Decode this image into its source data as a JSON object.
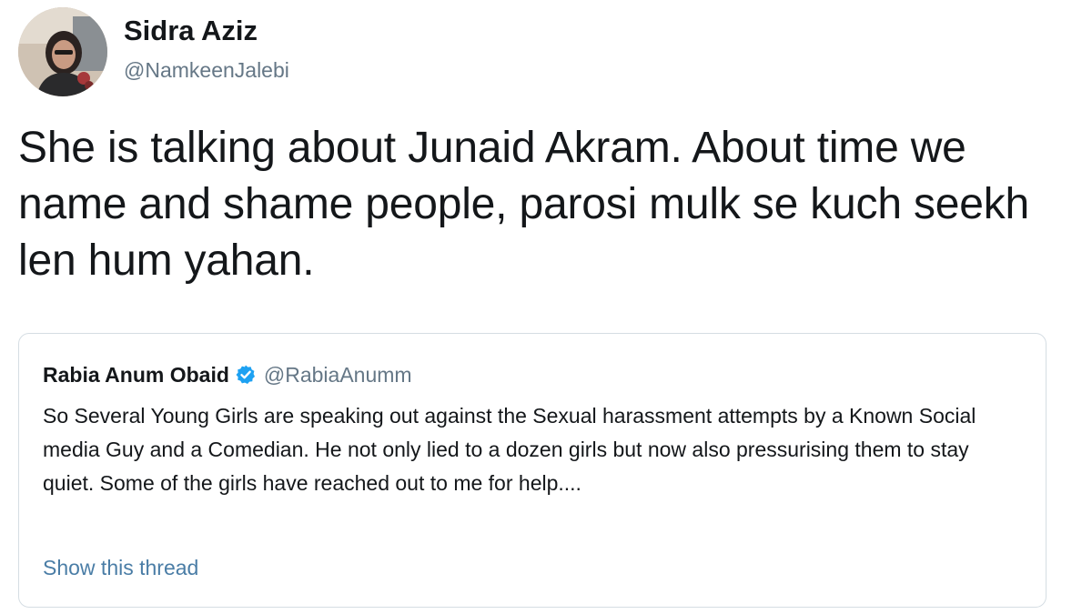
{
  "tweet": {
    "author": {
      "display_name": "Sidra Aziz",
      "handle": "@NamkeenJalebi",
      "avatar_icon": "profile-photo"
    },
    "text": "She is talking about Junaid Akram. About time we name and shame people, parosi mulk se kuch seekh len hum yahan."
  },
  "quoted_tweet": {
    "author": {
      "display_name": "Rabia Anum Obaid",
      "handle": "@RabiaAnumm",
      "verified": true,
      "verified_icon": "verified-badge-icon"
    },
    "text": "So Several Young Girls are speaking out against the Sexual harassment attempts by a Known Social media Guy and a Comedian. He not only lied to a dozen girls but now also pressurising them to stay quiet. Some of the girls have reached out to me for help....",
    "show_thread_label": "Show this thread"
  },
  "colors": {
    "primary_text": "#14171a",
    "secondary_text": "#657786",
    "link": "#4a7da6",
    "verified_blue": "#1da1f2",
    "card_border": "#d5dde3"
  }
}
